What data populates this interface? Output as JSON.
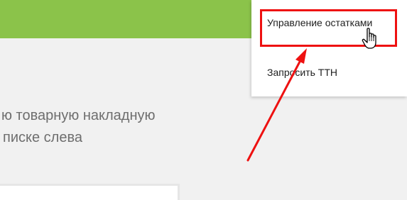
{
  "header": {
    "color": "#8bc34a"
  },
  "main": {
    "message_line1": "ю товарную накладную",
    "message_line2": "писке слева"
  },
  "dropdown_menu": {
    "items": [
      {
        "label": "Управление остатками",
        "highlighted": true
      },
      {
        "label": "Запросить ТТН"
      }
    ]
  },
  "annotation": {
    "color": "#ee1111",
    "cursor_icon": "hand-pointer-icon"
  }
}
